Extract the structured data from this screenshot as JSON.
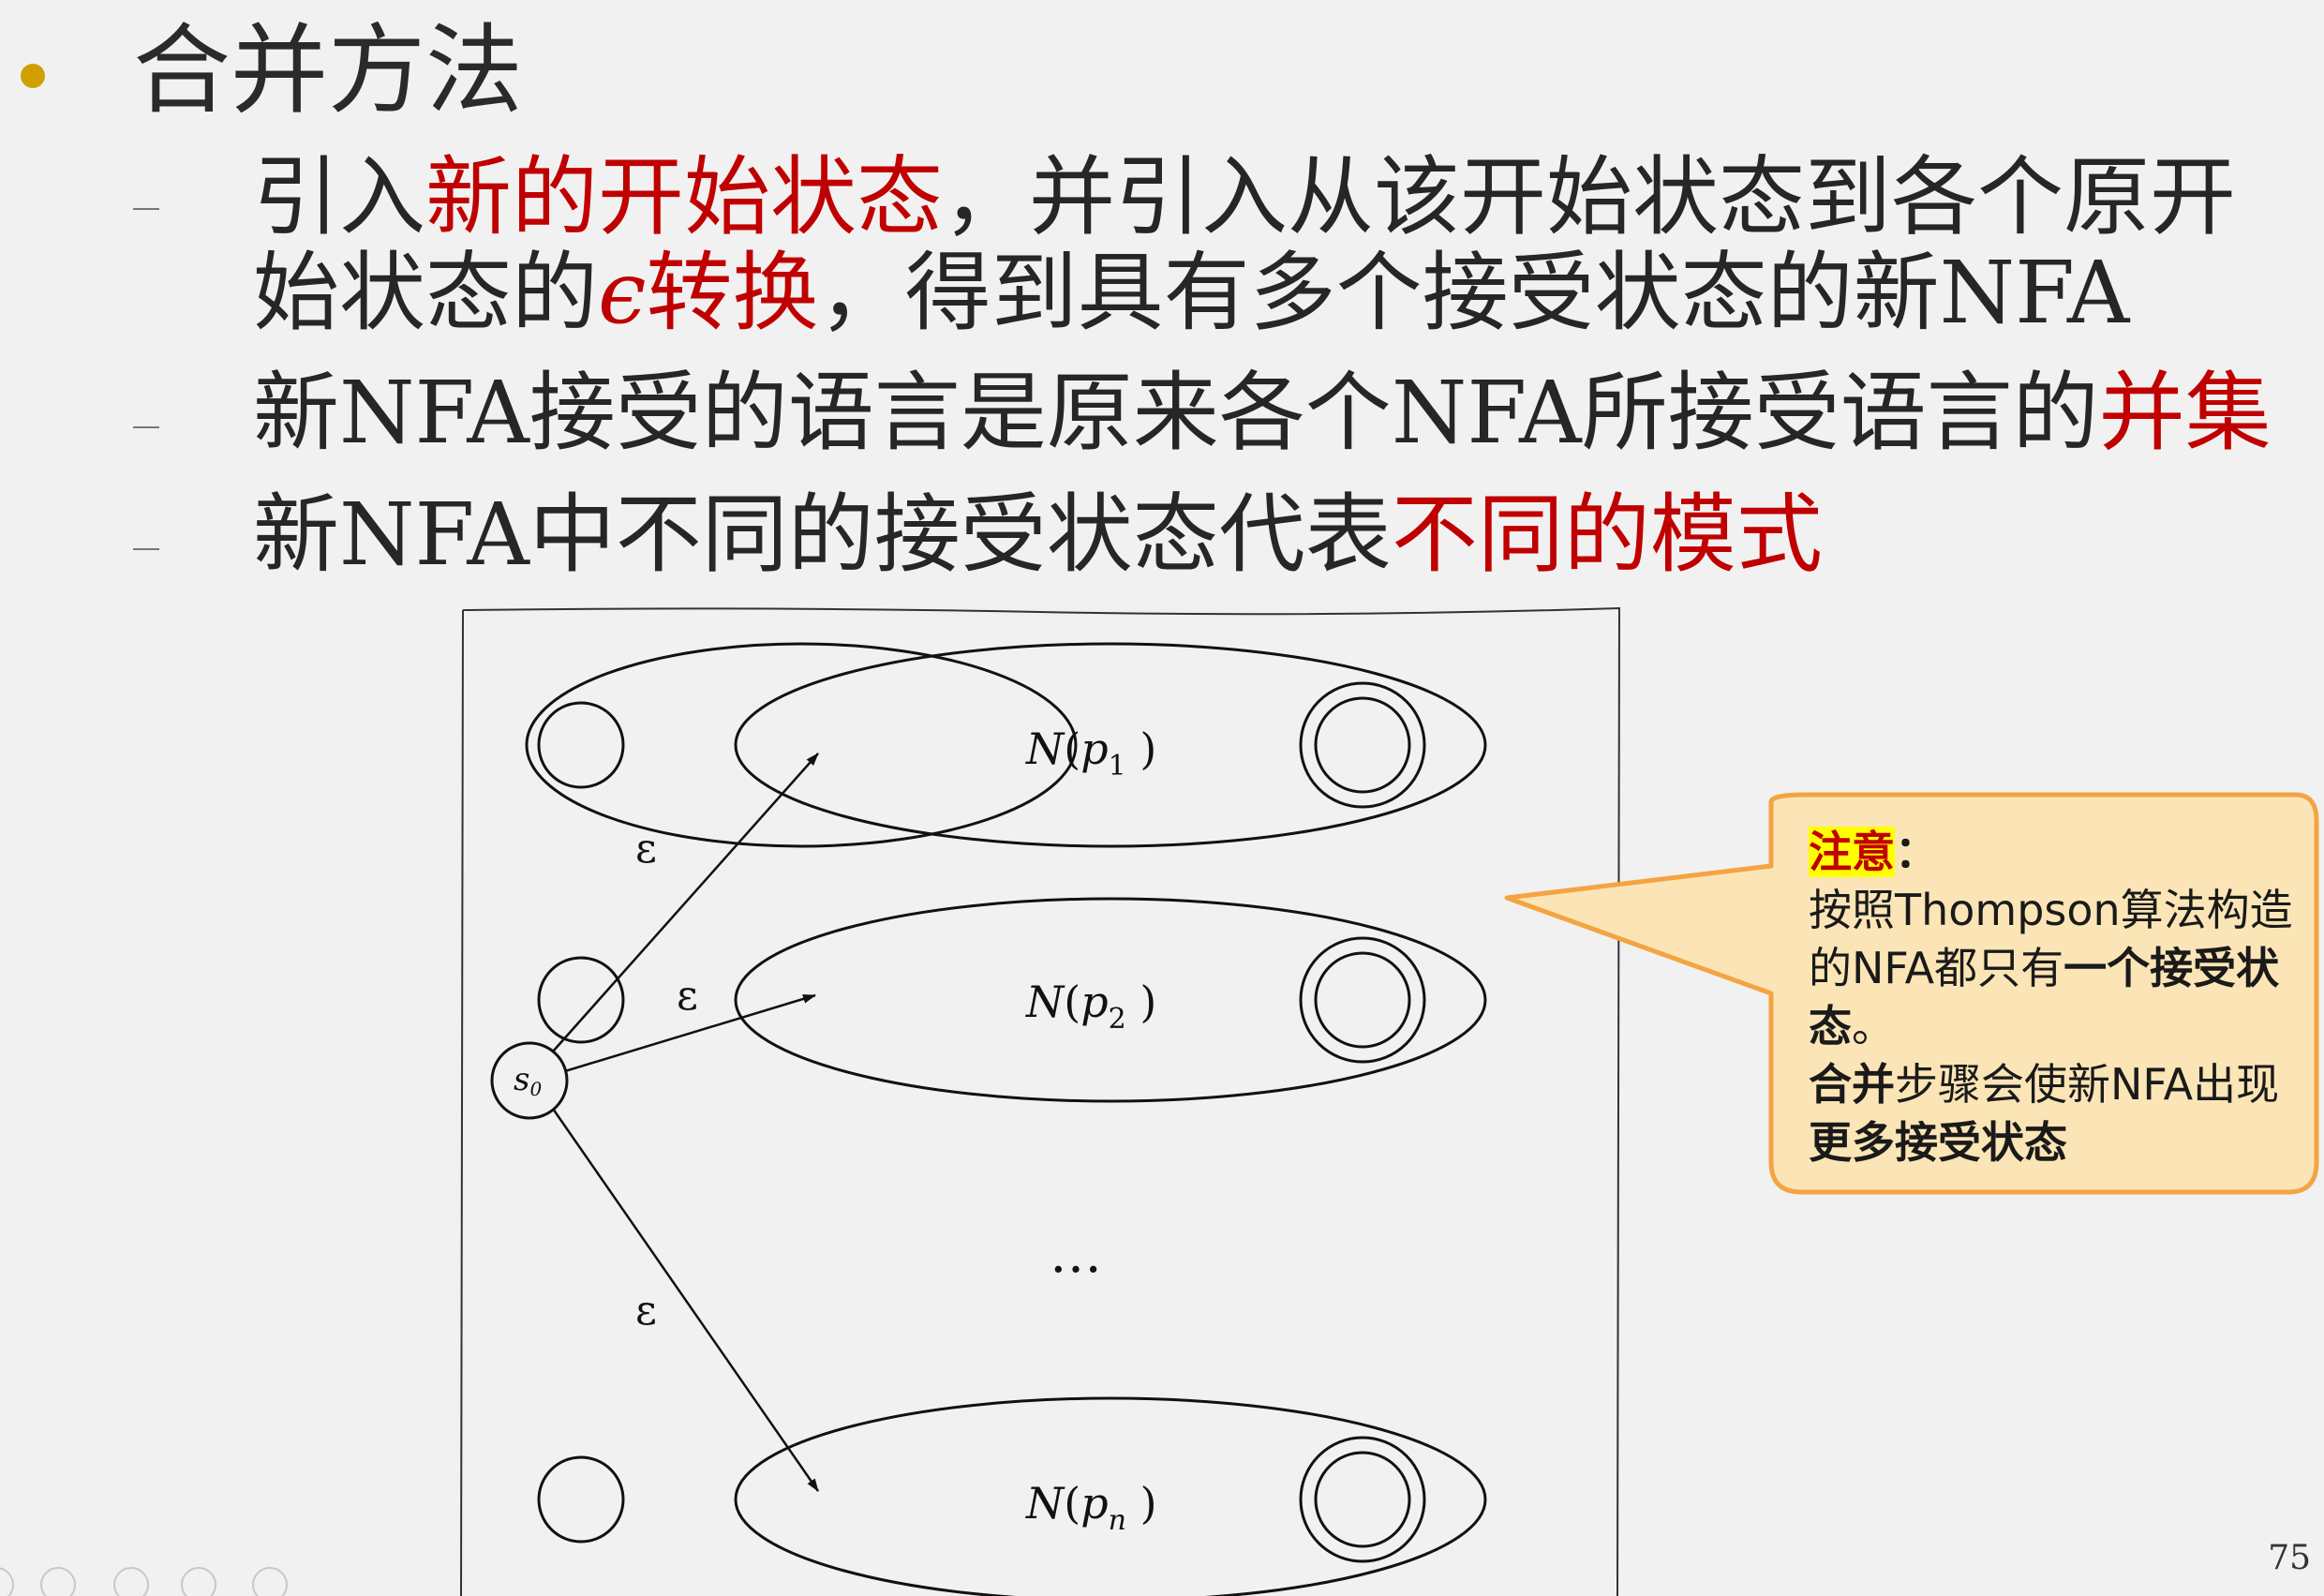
{
  "title": "合并方法",
  "bullets": [
    {
      "parts": [
        "引入",
        "新的开始状态",
        "，并引入从该开始状态到各个原开"
      ]
    },
    {
      "parts": [
        "始状态的",
        "ϵ",
        "转换",
        "，得到具有多个接受状态的新",
        "NFA"
      ]
    },
    {
      "parts": [
        "新",
        "NFA",
        "接受的语言是原来各个",
        "NFA",
        "所接受语言的",
        "并集"
      ]
    },
    {
      "parts": [
        "新",
        "NFA",
        "中不同的接受状态代表",
        "不同的模式"
      ]
    }
  ],
  "diagram": {
    "start_state": "s",
    "start_state_sub": "0",
    "epsilon": "ε",
    "automata": [
      {
        "name": "N",
        "arg": "p",
        "sub": "1"
      },
      {
        "name": "N",
        "arg": "p",
        "sub": "2"
      },
      {
        "name": "N",
        "arg": "p",
        "sub": "n"
      }
    ],
    "ellipsis": "…"
  },
  "callout": {
    "label": "注意",
    "colon": "：",
    "line1_pre": "按照Thompson算法构造的NFA都只有",
    "line1_bold": "一个接受状态",
    "line1_post": "。",
    "line2_bold": "合并",
    "line2_mid": "步骤会使新NFA出现",
    "line2_bold2": "更多接受状态"
  },
  "page_number": "75",
  "colors": {
    "accent_red": "#c00000",
    "bullet": "#d0a000",
    "callout_fill": "#fbe5b6",
    "callout_border": "#f4a442"
  }
}
